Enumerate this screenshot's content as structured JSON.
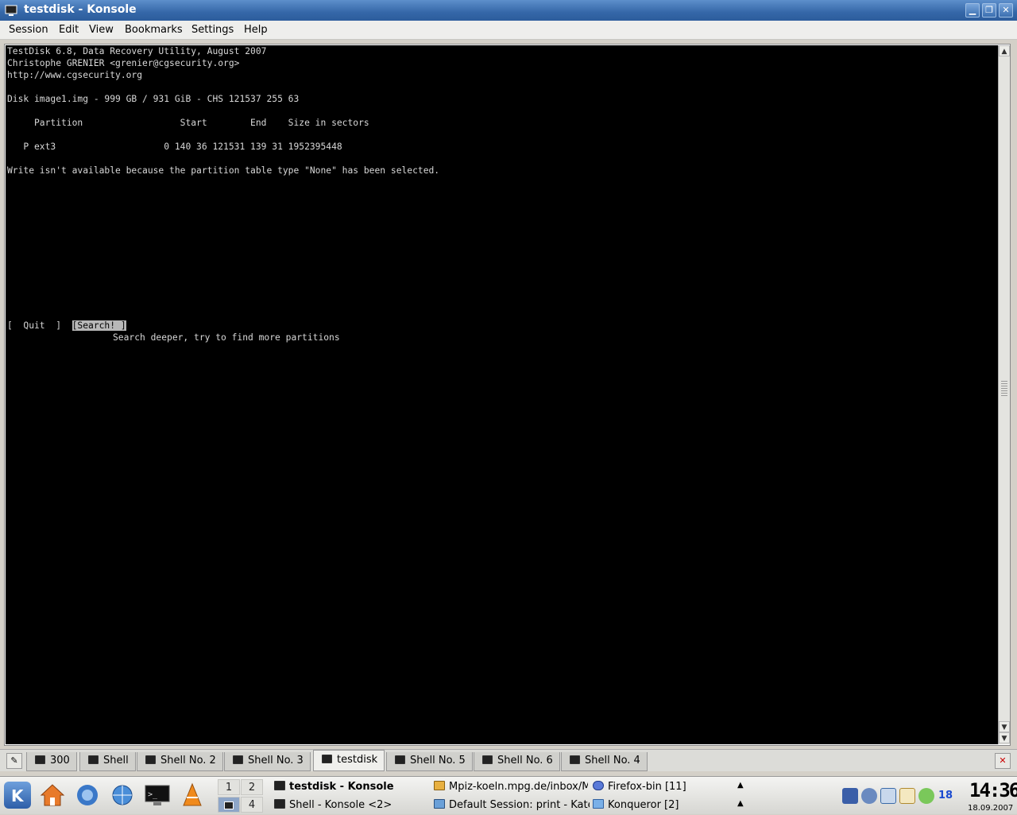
{
  "window": {
    "title": "testdisk - Konsole",
    "controls": {
      "minimize": "▁",
      "maximize": "❐",
      "close": "✕"
    }
  },
  "menubar": [
    "Session",
    "Edit",
    "View",
    "Bookmarks",
    "Settings",
    "Help"
  ],
  "terminal": {
    "header1": "TestDisk 6.8, Data Recovery Utility, August 2007",
    "header2": "Christophe GRENIER <grenier@cgsecurity.org>",
    "header3": "http://www.cgsecurity.org",
    "disk": "Disk image1.img - 999 GB / 931 GiB - CHS 121537 255 63",
    "columns": "     Partition                  Start        End    Size in sectors",
    "partition_row": "   P ext3                    0 140 36 121531 139 31 1952395448",
    "warning": "Write isn't available because the partition table type \"None\" has been selected.",
    "quit_prefix": "[  Quit  ]  ",
    "search_button": "[Search! ]",
    "search_hint": "Search deeper, try to find more partitions"
  },
  "tabs": [
    {
      "label": "300",
      "active": false
    },
    {
      "label": "Shell",
      "active": false
    },
    {
      "label": "Shell No. 2",
      "active": false
    },
    {
      "label": "Shell No. 3",
      "active": false
    },
    {
      "label": "testdisk",
      "active": true
    },
    {
      "label": "Shell No. 5",
      "active": false
    },
    {
      "label": "Shell No. 6",
      "active": false
    },
    {
      "label": "Shell No. 4",
      "active": false
    }
  ],
  "panel": {
    "pager": [
      "1",
      "2",
      "",
      "4"
    ],
    "tasks": {
      "t1": "testdisk - Konsole",
      "t2": "Shell - Konsole <2>",
      "t3": "Mpiz-koeln.mpg.de/inbox/Ma",
      "t4": "Default Session: print - Kate",
      "t5": "Firefox-bin [11]",
      "t6": "Konqueror [2]"
    },
    "tray_badge": "18",
    "clock_time": "14:36",
    "clock_date": "18.09.2007"
  },
  "colors": {
    "terminal_bg": "#000000",
    "terminal_fg": "#d8d8d8",
    "titlebar": "#3567a8"
  }
}
